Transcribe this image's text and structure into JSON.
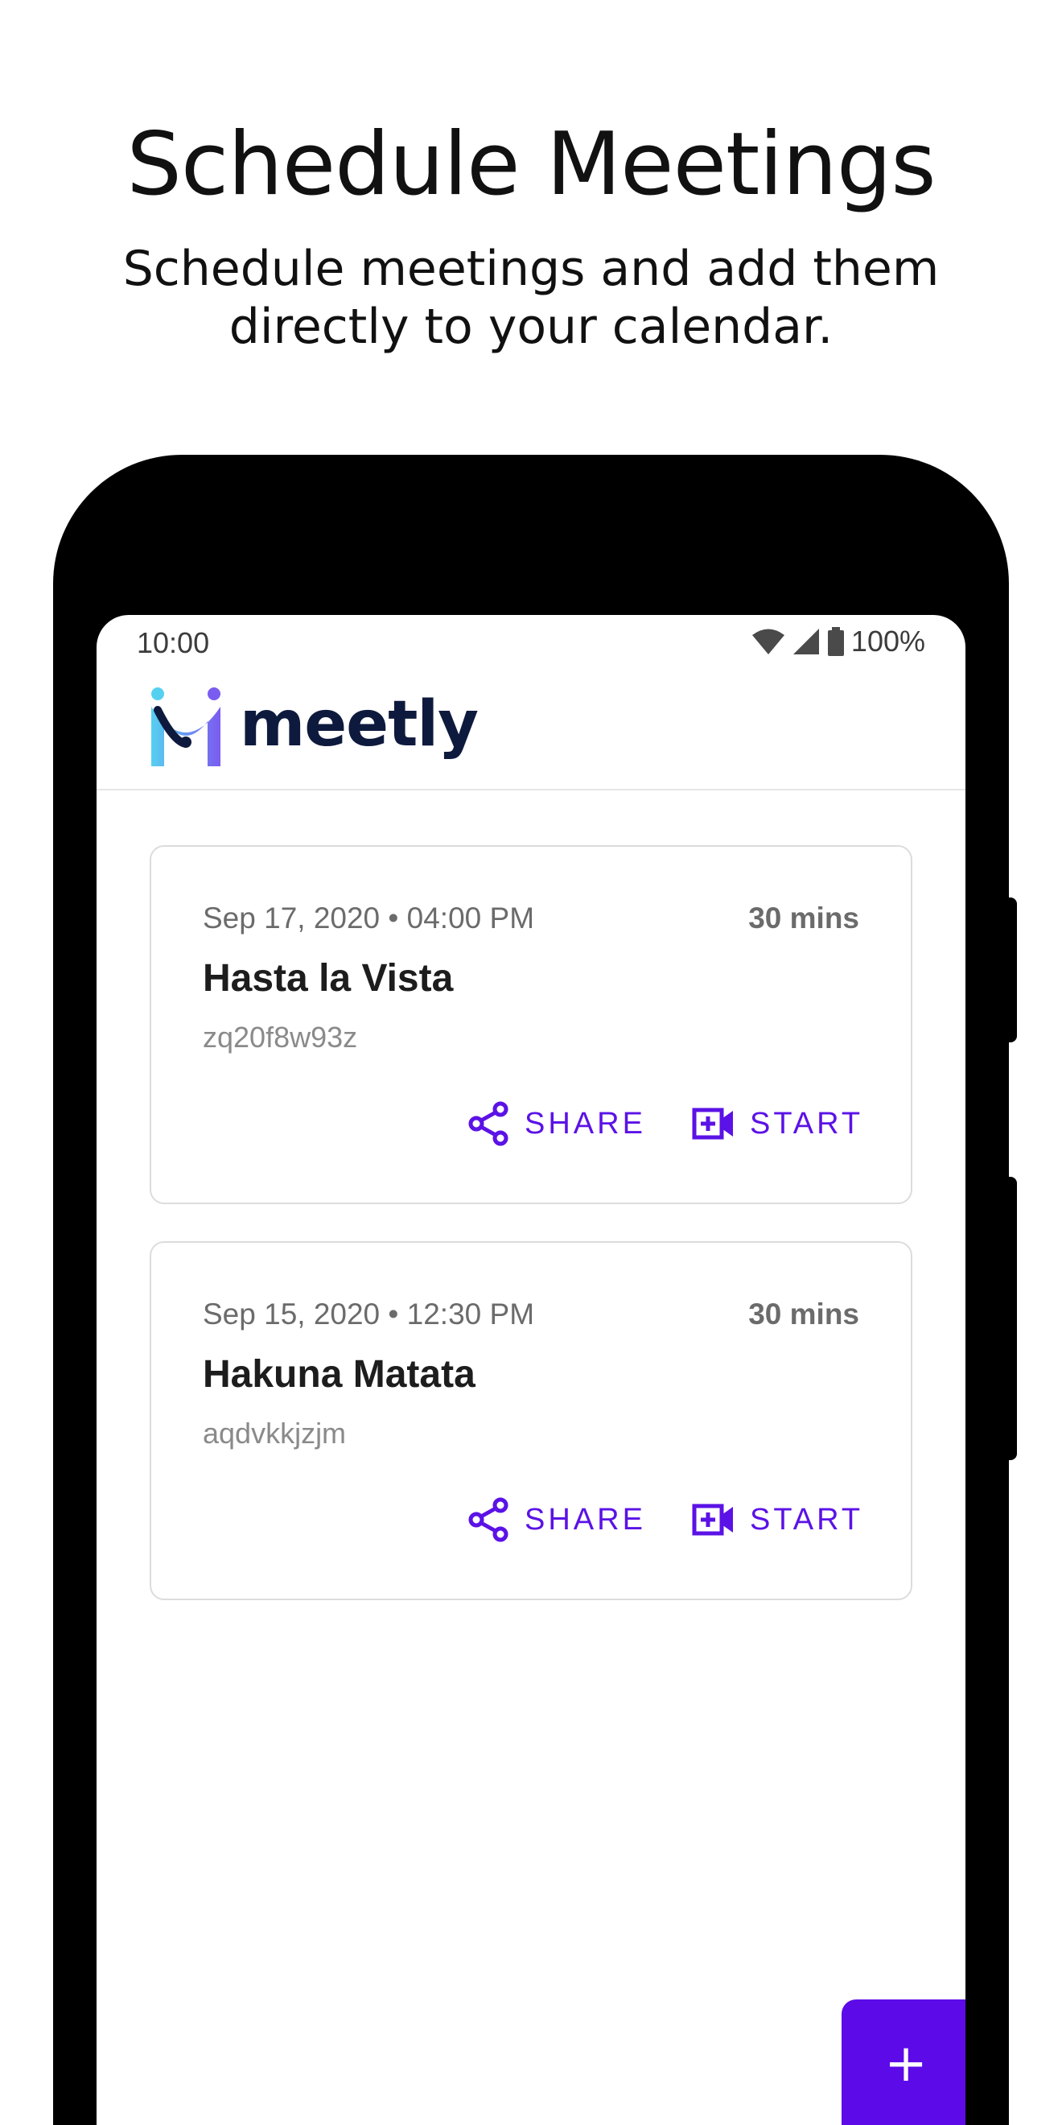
{
  "promo": {
    "title": "Schedule Meetings",
    "subtitle": "Schedule meetings and add them directly to your calendar."
  },
  "status_bar": {
    "time": "10:00",
    "battery": "100%",
    "icons": [
      "wifi-icon",
      "signal-icon",
      "battery-icon"
    ]
  },
  "app": {
    "name": "meetly",
    "brand_colors": {
      "logo_cyan": "#56d0f0",
      "logo_purple": "#7b5cf0",
      "logo_dark": "#0e1a3d",
      "accent": "#5d0ae8"
    }
  },
  "meetings": [
    {
      "when": "Sep 17, 2020 • 04:00 PM",
      "duration": "30 mins",
      "title": "Hasta la Vista",
      "code": "zq20f8w93z",
      "share_label": "SHARE",
      "start_label": "START"
    },
    {
      "when": "Sep 15, 2020 • 12:30 PM",
      "duration": "30 mins",
      "title": "Hakuna Matata",
      "code": "aqdvkkjzjm",
      "share_label": "SHARE",
      "start_label": "START"
    }
  ],
  "fab": {
    "label": "+"
  }
}
